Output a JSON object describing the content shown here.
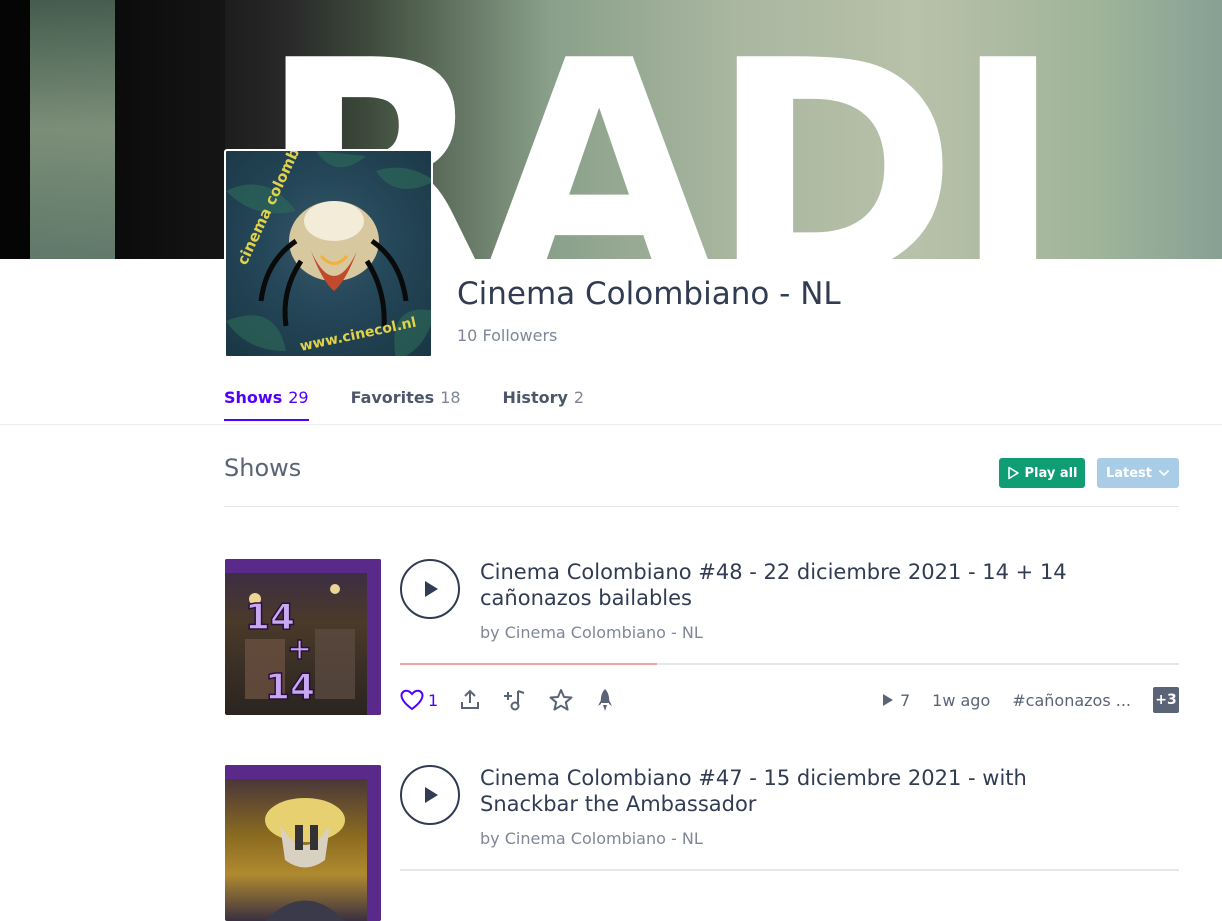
{
  "profile": {
    "name": "Cinema Colombiano - NL",
    "followers": "10 Followers",
    "avatar_logo_text": [
      "cinema colombiano",
      "www.cinecol.nl"
    ]
  },
  "banner": {
    "text": "RADI"
  },
  "tabs": [
    {
      "label": "Shows",
      "count": "29",
      "active": true
    },
    {
      "label": "Favorites",
      "count": "18",
      "active": false
    },
    {
      "label": "History",
      "count": "2",
      "active": false
    }
  ],
  "section": {
    "title": "Shows",
    "play_all_label": "Play all",
    "sort_label": "Latest"
  },
  "shows": [
    {
      "title": "Cinema Colombiano #48 - 22 diciembre 2021 - 14 + 14 cañonazos bailables",
      "by": "by Cinema Colombiano - NL",
      "progress": 0.33,
      "likes": "1",
      "plays": "7",
      "age": "1w ago",
      "tag": "#cañonazos ...",
      "more_tags": "+3",
      "thumb_text": "14+14"
    },
    {
      "title": "Cinema Colombiano #47 - 15 diciembre 2021 - with Snackbar the Ambassador",
      "by": "by Cinema Colombiano - NL",
      "progress": 0
    }
  ],
  "colors": {
    "accent": "#5000ff",
    "play_all": "#0f9e74",
    "latest": "#a9cde6",
    "text": "#313c53",
    "progress": "#f4a3a3"
  }
}
